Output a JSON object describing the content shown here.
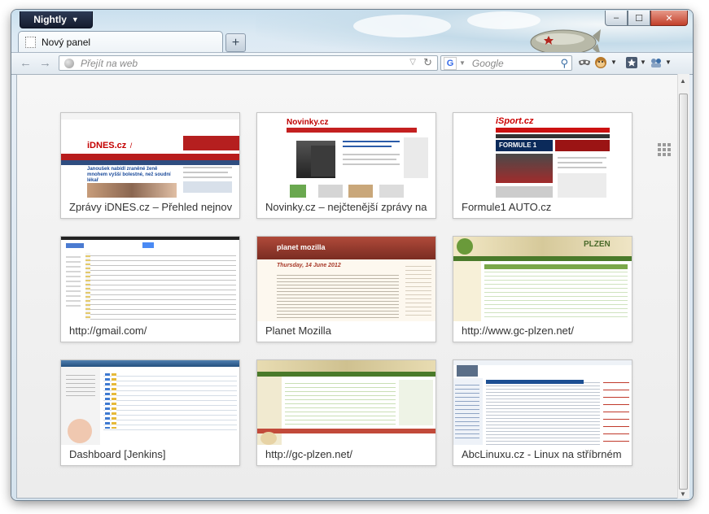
{
  "window": {
    "app_button_label": "Nightly",
    "caption": {
      "minimize": "–",
      "maximize": "☐",
      "close": "✕"
    }
  },
  "tabs": [
    {
      "label": "Nový panel"
    }
  ],
  "new_tab_glyph": "+",
  "toolbar": {
    "url_placeholder": "Přejít na web",
    "search_engine_glyph": "G",
    "search_placeholder": "Google",
    "icons": [
      "back-arrow-icon",
      "forward-arrow-icon",
      "globe-icon",
      "reload-icon",
      "magnifier-icon",
      "mask-icon",
      "monkey-icon",
      "bookmarks-icon",
      "addon-icon"
    ]
  },
  "colors": {
    "accent": "#3a6ea5",
    "close_button": "#c2402a"
  },
  "tiles": [
    {
      "title": "Zprávy iDNES.cz – Přehled nejnovějších"
    },
    {
      "title": "Novinky.cz  – nejčtenější zprávy na"
    },
    {
      "title": "Formule1 AUTO.cz"
    },
    {
      "title": "http://gmail.com/"
    },
    {
      "title": "Planet Mozilla"
    },
    {
      "title": "http://www.gc-plzen.net/"
    },
    {
      "title": "Dashboard [Jenkins]"
    },
    {
      "title": "http://gc-plzen.net/"
    },
    {
      "title": "AbcLinuxu.cz - Linux na stříbrném"
    }
  ],
  "thumbnails": {
    "idnes": {
      "logo": "iDNES.cz",
      "section": "/ Zprávy",
      "headline": "Janoušek nabídl zraněné ženě mnohem vyšší bolestné, než soudní lékař"
    },
    "novinky": {
      "logo": "Novinky.cz"
    },
    "isport": {
      "logo": "iSport.cz",
      "banner": "FORMULE 1"
    },
    "planet": {
      "header": "planet mozilla",
      "date": "Thursday, 14 June 2012"
    },
    "gcplzen": {
      "header": "PLZEN"
    }
  }
}
